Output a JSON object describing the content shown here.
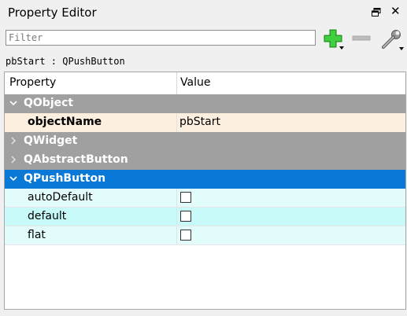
{
  "window": {
    "title": "Property Editor",
    "float_icon": "float-window-icon",
    "close_glyph": "✕"
  },
  "toolbar": {
    "filter_placeholder": "Filter",
    "filter_value": "",
    "add_icon": "add-dynamic-property-icon",
    "remove_icon": "remove-dynamic-property-icon",
    "config_icon": "configure-wrench-icon"
  },
  "object_label": "pbStart : QPushButton",
  "table": {
    "headers": [
      "Property",
      "Value"
    ],
    "groups": [
      {
        "label": "QObject",
        "expanded": true,
        "selected": false,
        "properties": [
          {
            "name": "objectName",
            "value": "pbStart",
            "bold": true,
            "type": "text",
            "bg": "#fdefdf"
          }
        ]
      },
      {
        "label": "QWidget",
        "expanded": false,
        "selected": false,
        "properties": []
      },
      {
        "label": "QAbstractButton",
        "expanded": false,
        "selected": false,
        "properties": []
      },
      {
        "label": "QPushButton",
        "expanded": true,
        "selected": true,
        "properties": [
          {
            "name": "autoDefault",
            "checked": false,
            "type": "checkbox",
            "bg": "#e2fcfc"
          },
          {
            "name": "default",
            "checked": false,
            "type": "checkbox",
            "bg": "#c8fafa"
          },
          {
            "name": "flat",
            "checked": false,
            "type": "checkbox",
            "bg": "#e2fcfc"
          }
        ]
      }
    ]
  },
  "colors": {
    "group_bg": "#a0a0a0",
    "group_selected_bg": "#0a78d7",
    "qobject_row_bg": "#fdefdf",
    "pushbutton_row_bg_a": "#e2fcfc",
    "pushbutton_row_bg_b": "#c8fafa",
    "add_green": "#2fb52f"
  }
}
